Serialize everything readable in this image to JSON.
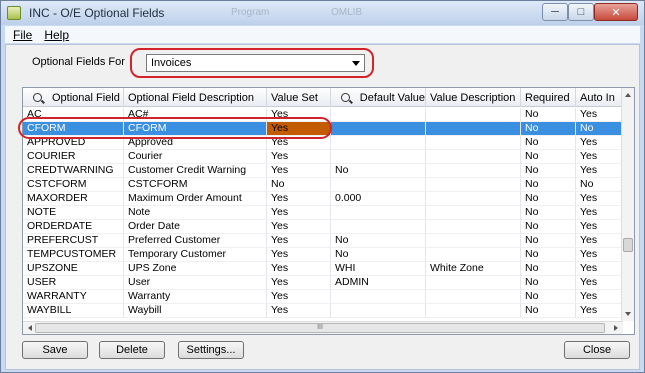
{
  "window": {
    "title": "INC - O/E Optional Fields",
    "ghost_text_1": "Program",
    "ghost_text_2": "OMLIB"
  },
  "menu": [
    {
      "label": "File"
    },
    {
      "label": "Help"
    }
  ],
  "optional_fields_for": {
    "label": "Optional Fields For",
    "selected": "Invoices"
  },
  "grid": {
    "columns": [
      "Optional Field",
      "Optional Field Description",
      "Value Set",
      "Default Value",
      "Value Description",
      "Required",
      "Auto In"
    ],
    "rows": [
      {
        "field": "AC",
        "desc": "AC#",
        "value_set": "Yes",
        "default": "",
        "value_desc": "",
        "required": "No",
        "auto": "Yes"
      },
      {
        "field": "CFORM",
        "desc": "CFORM",
        "value_set": "Yes",
        "default": "",
        "value_desc": "",
        "required": "No",
        "auto": "No"
      },
      {
        "field": "APPROVED",
        "desc": "Approved",
        "value_set": "Yes",
        "default": "",
        "value_desc": "",
        "required": "No",
        "auto": "Yes"
      },
      {
        "field": "COURIER",
        "desc": "Courier",
        "value_set": "Yes",
        "default": "",
        "value_desc": "",
        "required": "No",
        "auto": "Yes"
      },
      {
        "field": "CREDTWARNING",
        "desc": "Customer Credit Warning",
        "value_set": "Yes",
        "default": "No",
        "value_desc": "",
        "required": "No",
        "auto": "Yes"
      },
      {
        "field": "CSTCFORM",
        "desc": "CSTCFORM",
        "value_set": "No",
        "default": "",
        "value_desc": "",
        "required": "No",
        "auto": "No"
      },
      {
        "field": "MAXORDER",
        "desc": "Maximum Order Amount",
        "value_set": "Yes",
        "default": "0.000",
        "value_desc": "",
        "required": "No",
        "auto": "Yes"
      },
      {
        "field": "NOTE",
        "desc": "Note",
        "value_set": "Yes",
        "default": "",
        "value_desc": "",
        "required": "No",
        "auto": "Yes"
      },
      {
        "field": "ORDERDATE",
        "desc": "Order Date",
        "value_set": "Yes",
        "default": "",
        "value_desc": "",
        "required": "No",
        "auto": "Yes"
      },
      {
        "field": "PREFERCUST",
        "desc": "Preferred Customer",
        "value_set": "Yes",
        "default": "No",
        "value_desc": "",
        "required": "No",
        "auto": "Yes"
      },
      {
        "field": "TEMPCUSTOMER",
        "desc": "Temporary Customer",
        "value_set": "Yes",
        "default": "No",
        "value_desc": "",
        "required": "No",
        "auto": "Yes"
      },
      {
        "field": "UPSZONE",
        "desc": "UPS Zone",
        "value_set": "Yes",
        "default": "WHI",
        "value_desc": "White Zone",
        "required": "No",
        "auto": "Yes"
      },
      {
        "field": "USER",
        "desc": "User",
        "value_set": "Yes",
        "default": "ADMIN",
        "value_desc": "",
        "required": "No",
        "auto": "Yes"
      },
      {
        "field": "WARRANTY",
        "desc": "Warranty",
        "value_set": "Yes",
        "default": "",
        "value_desc": "",
        "required": "No",
        "auto": "Yes"
      },
      {
        "field": "WAYBILL",
        "desc": "Waybill",
        "value_set": "Yes",
        "default": "",
        "value_desc": "",
        "required": "No",
        "auto": "Yes"
      }
    ],
    "scroll_grip": "III"
  },
  "buttons": {
    "save": "Save",
    "delete": "Delete",
    "settings": "Settings...",
    "close": "Close"
  }
}
